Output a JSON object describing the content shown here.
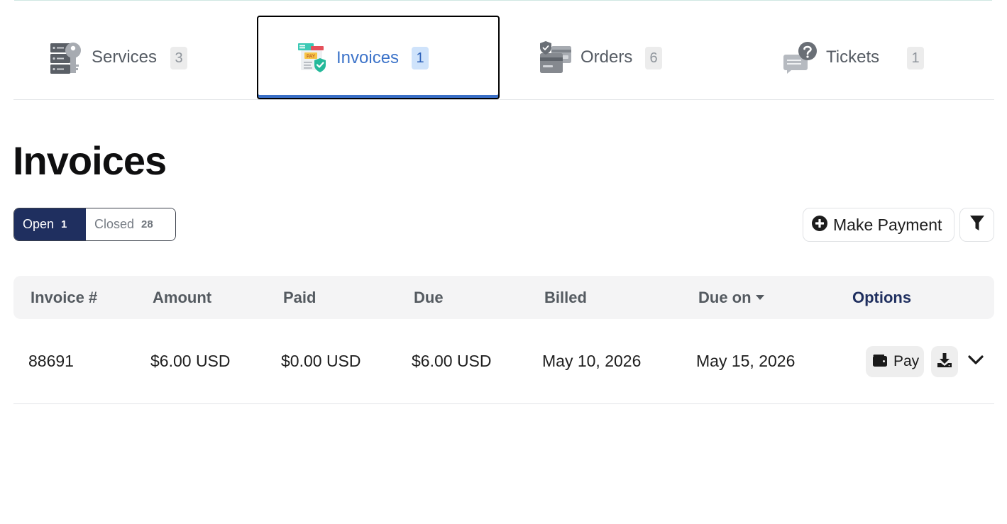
{
  "tabs": [
    {
      "label": "Services",
      "count": "3",
      "icon": "server-key-icon"
    },
    {
      "label": "Invoices",
      "count": "1",
      "icon": "invoice-pay-icon"
    },
    {
      "label": "Orders",
      "count": "6",
      "icon": "order-card-icon"
    },
    {
      "label": "Tickets",
      "count": "1",
      "icon": "support-ticket-icon"
    }
  ],
  "active_tab": "Invoices",
  "page_title": "Invoices",
  "filter": {
    "open_label": "Open",
    "open_count": "1",
    "closed_label": "Closed",
    "closed_count": "28",
    "selected": "Open"
  },
  "actions": {
    "make_payment_label": "Make Payment",
    "make_payment_icon": "plus-circle-icon",
    "filter_icon": "funnel-icon"
  },
  "table": {
    "columns": [
      "Invoice #",
      "Amount",
      "Paid",
      "Due",
      "Billed",
      "Due on",
      "Options"
    ],
    "sort_column": "Due on",
    "rows": [
      {
        "invoice": "88691",
        "amount": "$6.00 USD",
        "paid": "$0.00 USD",
        "due": "$6.00 USD",
        "billed": "May 10, 2026",
        "due_on": "May 15, 2026",
        "pay_label": "Pay"
      }
    ]
  },
  "colors": {
    "accent": "#3c73c9",
    "navy": "#1f2f5f",
    "muted_text": "#555b63"
  }
}
